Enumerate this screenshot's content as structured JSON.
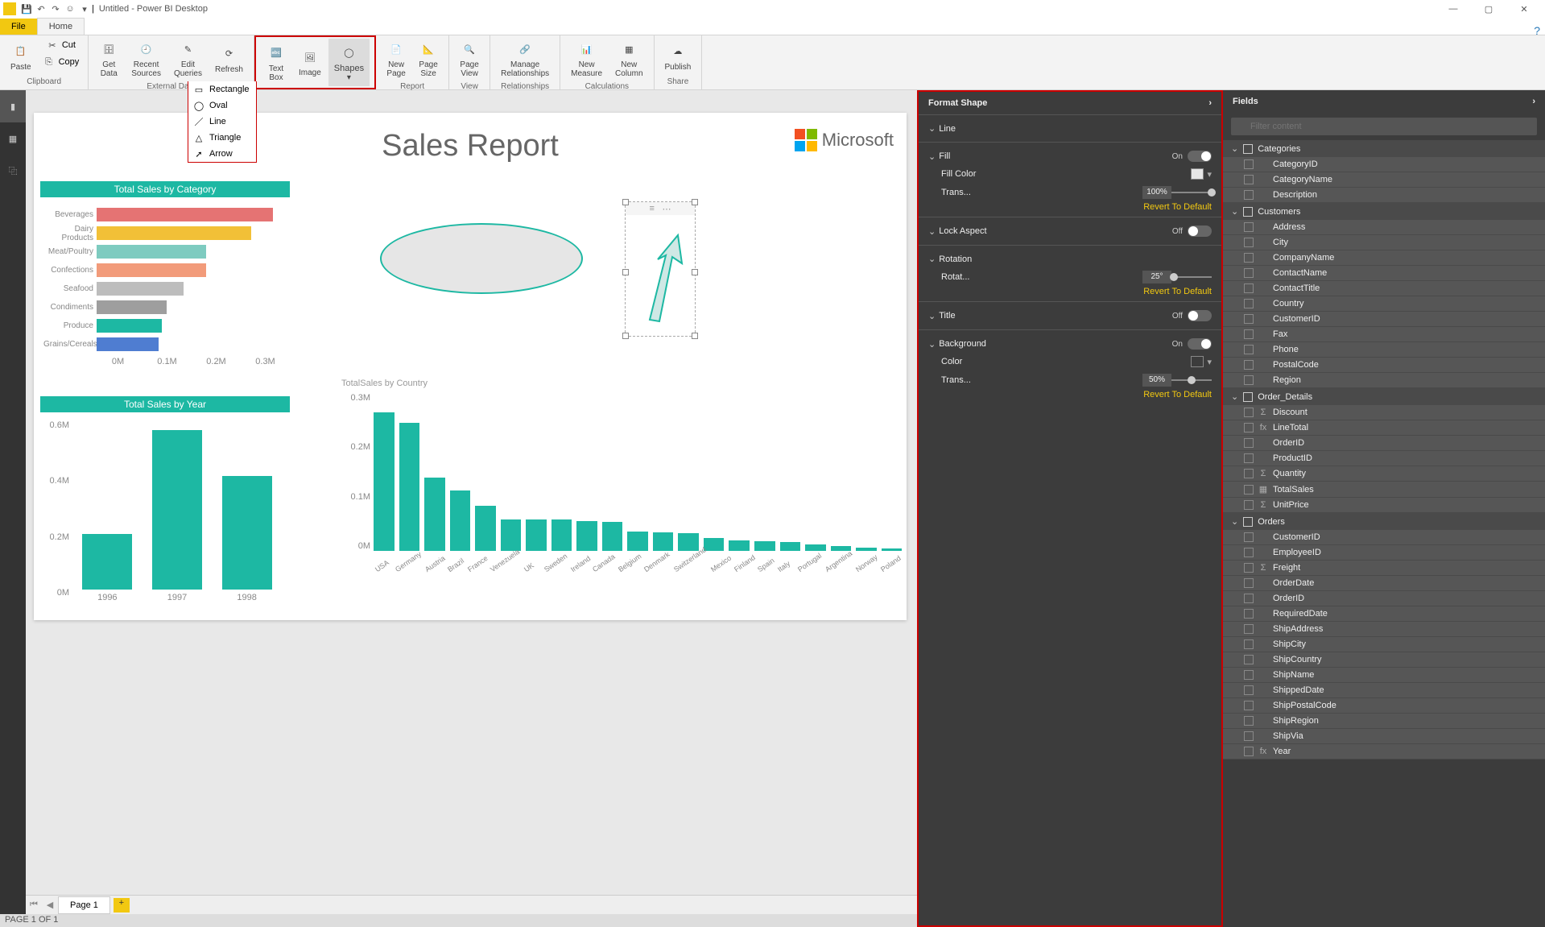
{
  "titlebar": {
    "title": "Untitled - Power BI Desktop"
  },
  "tabs": {
    "file": "File",
    "home": "Home"
  },
  "ribbon": {
    "clipboard": {
      "label": "Clipboard",
      "paste": "Paste",
      "cut": "Cut",
      "copy": "Copy"
    },
    "external": {
      "label": "External Data",
      "getdata": "Get\nData",
      "recent": "Recent\nSources",
      "edit": "Edit\nQueries",
      "refresh": "Refresh"
    },
    "insert": {
      "textbox": "Text\nBox",
      "image": "Image",
      "shapes": "Shapes"
    },
    "report": {
      "label": "Report",
      "newpage": "New\nPage",
      "pagesize": "Page\nSize"
    },
    "view": {
      "label": "View",
      "pageview": "Page\nView"
    },
    "rel": {
      "label": "Relationships",
      "manage": "Manage\nRelationships"
    },
    "calc": {
      "label": "Calculations",
      "newmeasure": "New\nMeasure",
      "newcolumn": "New\nColumn"
    },
    "share": {
      "label": "Share",
      "publish": "Publish"
    }
  },
  "shapes_menu": {
    "rectangle": "Rectangle",
    "oval": "Oval",
    "line": "Line",
    "triangle": "Triangle",
    "arrow": "Arrow"
  },
  "canvas": {
    "title": "Sales Report",
    "mslogo": "Microsoft"
  },
  "chart_data": [
    {
      "type": "bar",
      "orientation": "horizontal",
      "title": "Total Sales by Category",
      "categories": [
        "Beverages",
        "Dairy Products",
        "Meat/Poultry",
        "Confections",
        "Seafood",
        "Condiments",
        "Produce",
        "Grains/Cereals"
      ],
      "values": [
        0.286,
        0.251,
        0.178,
        0.177,
        0.141,
        0.114,
        0.105,
        0.1
      ],
      "colors": [
        "#e57373",
        "#f2c037",
        "#7ecbc0",
        "#f29b7a",
        "#bdbdbd",
        "#9e9e9e",
        "#1db8a3",
        "#4f7dd1"
      ],
      "xticks": [
        "0M",
        "0.1M",
        "0.2M",
        "0.3M"
      ],
      "xlim": [
        0,
        0.3
      ]
    },
    {
      "type": "bar",
      "title": "Total Sales by Year",
      "categories": [
        "1996",
        "1997",
        "1998"
      ],
      "values": [
        0.23,
        0.66,
        0.47
      ],
      "yticks": [
        "0M",
        "0.2M",
        "0.4M",
        "0.6M"
      ],
      "ylim": [
        0,
        0.7
      ],
      "color": "#1db8a3"
    },
    {
      "type": "bar",
      "title": "TotalSales by Country",
      "categories": [
        "USA",
        "Germany",
        "Austria",
        "Brazil",
        "France",
        "Venezuela",
        "UK",
        "Sweden",
        "Ireland",
        "Canada",
        "Belgium",
        "Denmark",
        "Switzerland",
        "Mexico",
        "Finland",
        "Spain",
        "Italy",
        "Portugal",
        "Argentina",
        "Norway",
        "Poland"
      ],
      "values": [
        0.263,
        0.244,
        0.139,
        0.115,
        0.085,
        0.06,
        0.06,
        0.059,
        0.057,
        0.055,
        0.036,
        0.035,
        0.033,
        0.024,
        0.02,
        0.019,
        0.017,
        0.013,
        0.009,
        0.006,
        0.004
      ],
      "yticks": [
        "0M",
        "0.1M",
        "0.2M",
        "0.3M"
      ],
      "ylim": [
        0,
        0.3
      ],
      "color": "#1db8a3"
    }
  ],
  "format": {
    "title": "Format Shape",
    "line": "Line",
    "fill": "Fill",
    "fill_on": "On",
    "fillcolor": "Fill Color",
    "trans": "Trans...",
    "trans_val": "100%",
    "revert": "Revert To Default",
    "lockaspect": "Lock Aspect",
    "lock_off": "Off",
    "rotation": "Rotation",
    "rotat": "Rotat...",
    "rotat_val": "25°",
    "title_sec": "Title",
    "title_off": "Off",
    "background": "Background",
    "bg_on": "On",
    "color": "Color",
    "bg_trans_val": "50%"
  },
  "fields": {
    "title": "Fields",
    "search_ph": "Filter content",
    "tables": [
      {
        "name": "Categories",
        "fields": [
          {
            "n": "CategoryID"
          },
          {
            "n": "CategoryName"
          },
          {
            "n": "Description"
          }
        ]
      },
      {
        "name": "Customers",
        "fields": [
          {
            "n": "Address"
          },
          {
            "n": "City"
          },
          {
            "n": "CompanyName"
          },
          {
            "n": "ContactName"
          },
          {
            "n": "ContactTitle"
          },
          {
            "n": "Country"
          },
          {
            "n": "CustomerID"
          },
          {
            "n": "Fax"
          },
          {
            "n": "Phone"
          },
          {
            "n": "PostalCode"
          },
          {
            "n": "Region"
          }
        ]
      },
      {
        "name": "Order_Details",
        "fields": [
          {
            "n": "Discount",
            "i": "Σ"
          },
          {
            "n": "LineTotal",
            "i": "fx"
          },
          {
            "n": "OrderID"
          },
          {
            "n": "ProductID"
          },
          {
            "n": "Quantity",
            "i": "Σ"
          },
          {
            "n": "TotalSales",
            "i": "▦"
          },
          {
            "n": "UnitPrice",
            "i": "Σ"
          }
        ]
      },
      {
        "name": "Orders",
        "fields": [
          {
            "n": "CustomerID"
          },
          {
            "n": "EmployeeID"
          },
          {
            "n": "Freight",
            "i": "Σ"
          },
          {
            "n": "OrderDate"
          },
          {
            "n": "OrderID"
          },
          {
            "n": "RequiredDate"
          },
          {
            "n": "ShipAddress"
          },
          {
            "n": "ShipCity"
          },
          {
            "n": "ShipCountry"
          },
          {
            "n": "ShipName"
          },
          {
            "n": "ShippedDate"
          },
          {
            "n": "ShipPostalCode"
          },
          {
            "n": "ShipRegion"
          },
          {
            "n": "ShipVia"
          },
          {
            "n": "Year",
            "i": "fx"
          }
        ]
      }
    ]
  },
  "page_tabs": {
    "page1": "Page 1"
  },
  "status": {
    "page": "PAGE 1 OF 1"
  }
}
